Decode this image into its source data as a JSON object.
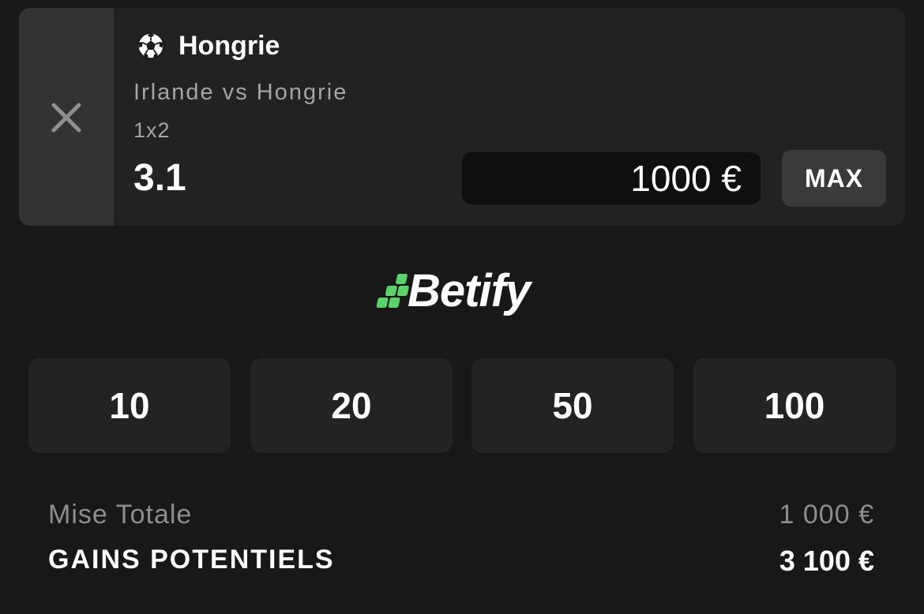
{
  "bet": {
    "selection": "Hongrie",
    "match": "Irlande vs Hongrie",
    "market": "1x2",
    "odds": "3.1",
    "stake_value": "1000 €",
    "max_label": "MAX"
  },
  "brand": {
    "name": "Betify",
    "accent_color": "#5bd36a"
  },
  "quick_stakes": [
    "10",
    "20",
    "50",
    "100"
  ],
  "summary": {
    "total_label": "Mise Totale",
    "total_value": "1 000 €",
    "gains_label": "GAINS POTENTIELS",
    "gains_value": "3 100 €"
  },
  "icons": {
    "remove": "close-icon",
    "sport": "soccer-ball-icon",
    "logo": "betify-logo-icon"
  }
}
